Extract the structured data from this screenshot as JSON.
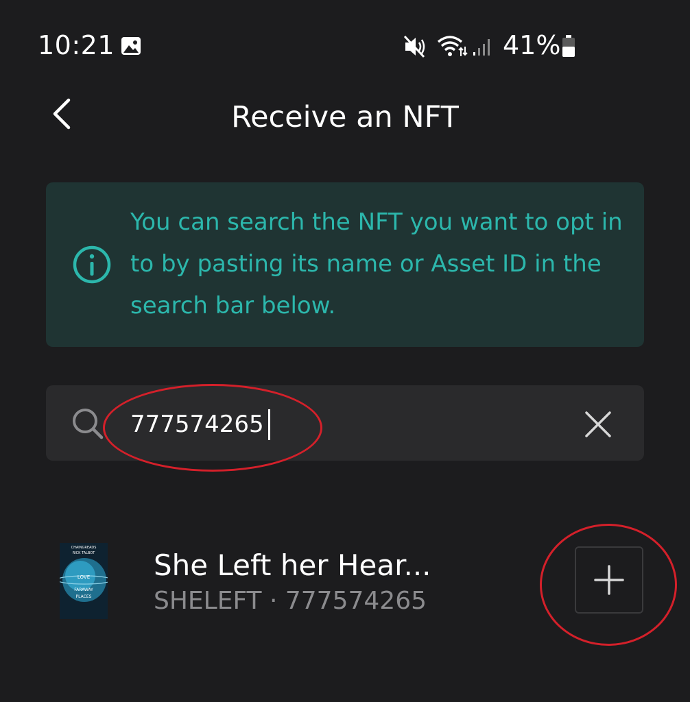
{
  "status_bar": {
    "time": "10:21",
    "battery": "41%",
    "icons": [
      "gallery-icon",
      "mute-icon",
      "wifi-icon",
      "signal-icon",
      "battery-icon"
    ]
  },
  "header": {
    "title": "Receive an NFT",
    "back_icon": "chevron-left-icon"
  },
  "info": {
    "icon": "info-icon",
    "text": "You can search the NFT you want to opt in to by pasting its name or Asset ID in the search bar below."
  },
  "search": {
    "value": "777574265",
    "icon": "search-icon",
    "clear_icon": "close-icon"
  },
  "results": [
    {
      "name": "She Left her Hear...",
      "meta": "SHELEFT · 777574265",
      "thumbnail_lines": [
        "CHAINGREADS",
        "RICK TALBOT",
        "LOVE",
        "FARAWAY",
        "PLACES"
      ],
      "action_icon": "plus-icon"
    }
  ],
  "colors": {
    "background": "#1c1c1e",
    "info_bg": "#1f3433",
    "accent": "#2cb7ac",
    "search_bg": "#2a2a2c",
    "muted_text": "#8b8b8e",
    "annotation": "#d4202a"
  }
}
